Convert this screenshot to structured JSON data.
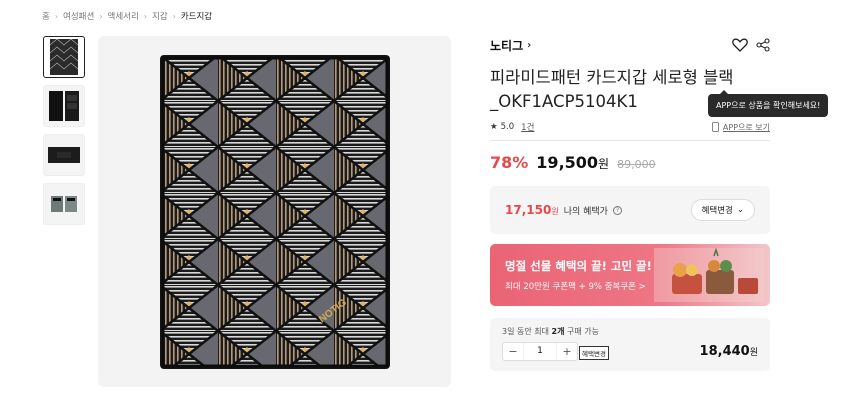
{
  "breadcrumb": [
    "홈",
    "여성패션",
    "액세서리",
    "지갑",
    "카드지갑"
  ],
  "thumbnails": [
    "wallet-pattern-front",
    "wallet-open-black",
    "wallet-flat-black",
    "wallet-open-interior"
  ],
  "product": {
    "brand": "노티그",
    "title": "피라미드패턴 카드지갑 세로형 블랙 _OKF1ACP5104K1",
    "rating": "5.0",
    "review_count": "1건",
    "app_link": "APP으로 보기",
    "tooltip": "APP으로 상품을 확인해보세요!",
    "discount": "78%",
    "price": "19,500",
    "price_unit": "원",
    "original_price": "89,000"
  },
  "benefit": {
    "price": "17,150",
    "unit": "원",
    "label": "나의 혜택가",
    "button": "혜택변경"
  },
  "banner": {
    "title": "명절 선물 혜택의 끝! 고민 끝!",
    "subtitle": "최대 20만원 쿠폰팩 + 9% 중복쿠폰 >"
  },
  "order": {
    "limit_prefix": "3일 동안 최대",
    "limit_qty": "2개",
    "limit_suffix": "구매 가능",
    "quantity": "1",
    "mini_button": "혜택변경",
    "price": "18,440",
    "unit": "원"
  },
  "colors": {
    "accent": "#e5484d",
    "banner": "#ea6474"
  }
}
